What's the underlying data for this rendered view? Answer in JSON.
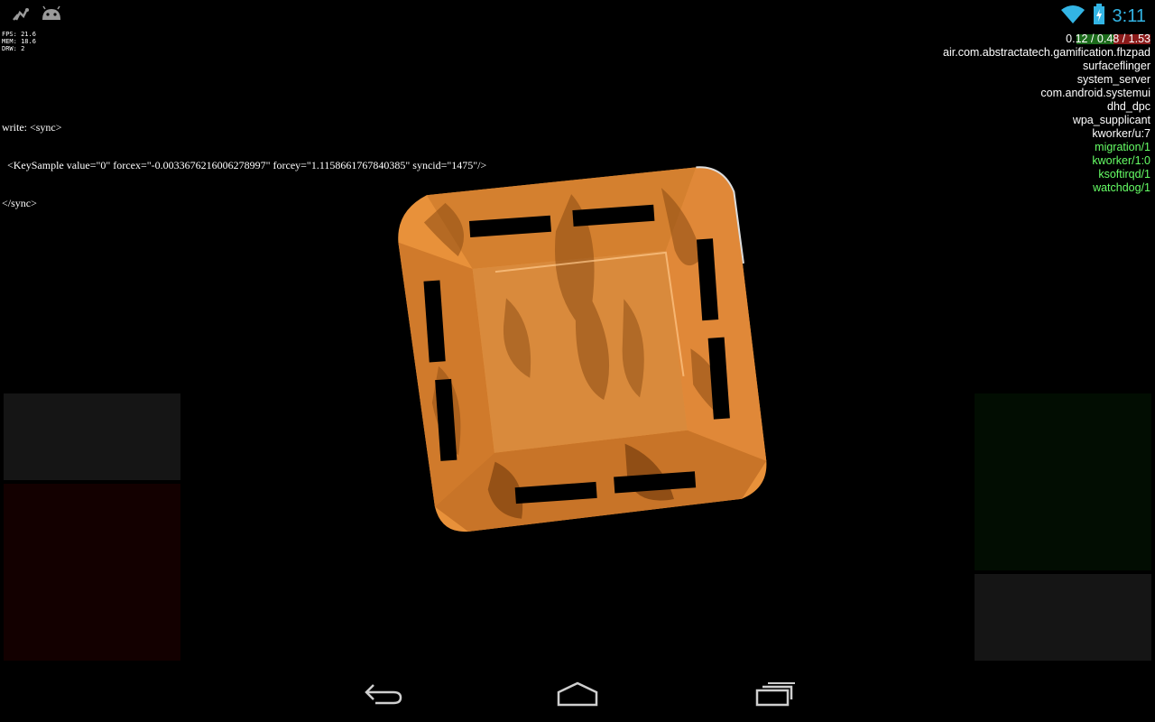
{
  "status_bar": {
    "notification_icons": [
      "usb-debug-icon",
      "android-debug-icon"
    ],
    "system_icons": [
      "wifi-icon",
      "battery-charging-icon"
    ],
    "clock": "3:11",
    "accent_color": "#33b5e5"
  },
  "perf_overlay": {
    "fps": "FPS: 21.6",
    "mem": "MEM: 18.6",
    "drw": "DRW: 2"
  },
  "sync_log": {
    "line1": "write: <sync>",
    "line2": "  <KeySample value=\"0\" forcex=\"-0.0033676216006278997\" forcey=\"1.1158661767840385\" syncid=\"1475\"/>",
    "line3": "</sync>"
  },
  "load_panel": {
    "load_average": "0.12 / 0.48 / 1.53",
    "processes": [
      {
        "name": "air.com.abstractatech.gamification.fhzpad",
        "color": "#ffffff"
      },
      {
        "name": "surfaceflinger",
        "color": "#ffffff"
      },
      {
        "name": "system_server",
        "color": "#ffffff"
      },
      {
        "name": "com.android.systemui",
        "color": "#ffffff"
      },
      {
        "name": "dhd_dpc",
        "color": "#ffffff"
      },
      {
        "name": "wpa_supplicant",
        "color": "#ffffff"
      },
      {
        "name": "kworker/u:7",
        "color": "#ffffff"
      },
      {
        "name": "migration/1",
        "color": "#66ff66"
      },
      {
        "name": "kworker/1:0",
        "color": "#66ff66"
      },
      {
        "name": "ksoftirqd/1",
        "color": "#66ff66"
      },
      {
        "name": "watchdog/1",
        "color": "#66ff66"
      }
    ]
  },
  "game": {
    "object": "orange-block",
    "block_color": "#e8913a"
  },
  "touch_pads": {
    "left_top_color": "#151515",
    "left_bottom_color": "#130000",
    "right_top_color": "#020d02",
    "right_bottom_color": "#151515"
  },
  "nav_bar": {
    "buttons": [
      "back-icon",
      "home-icon",
      "recents-icon"
    ]
  }
}
